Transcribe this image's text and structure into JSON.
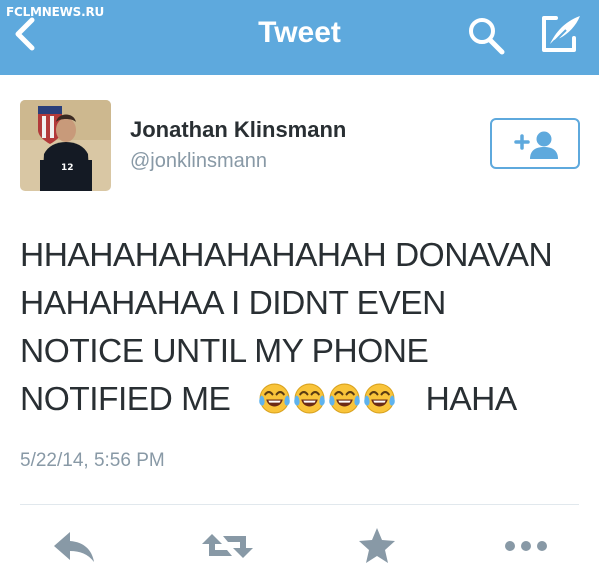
{
  "watermark": "FCLMNEWS.RU",
  "navbar": {
    "title": "Tweet",
    "color": "#5ea9dd",
    "icons": [
      "back-chevron-icon",
      "search-icon",
      "compose-icon"
    ]
  },
  "user": {
    "name": "Jonathan Klinsmann",
    "handle": "@jonklinsmann",
    "avatar_jersey_number": "12",
    "follow_icon": "add-user-icon"
  },
  "tweet": {
    "lines": [
      "HHAHAHAHAHAHAHAH DONAVAN",
      "HAHAHAHAA I DIDNT EVEN",
      "NOTICE UNTIL MY PHONE"
    ],
    "last_line_start": "NOTIFIED ME",
    "emoji": "face-with-tears-of-joy",
    "emoji_count": 4,
    "last_line_end": "HAHA",
    "timestamp": "5/22/14, 5:56 PM"
  },
  "actions": [
    "reply-icon",
    "retweet-icon",
    "favorite-star-icon",
    "more-dots-icon"
  ],
  "colors": {
    "accent": "#5ea9dd",
    "text": "#292f33",
    "secondary_text": "#8899a6",
    "action_icon": "#8899a6"
  }
}
